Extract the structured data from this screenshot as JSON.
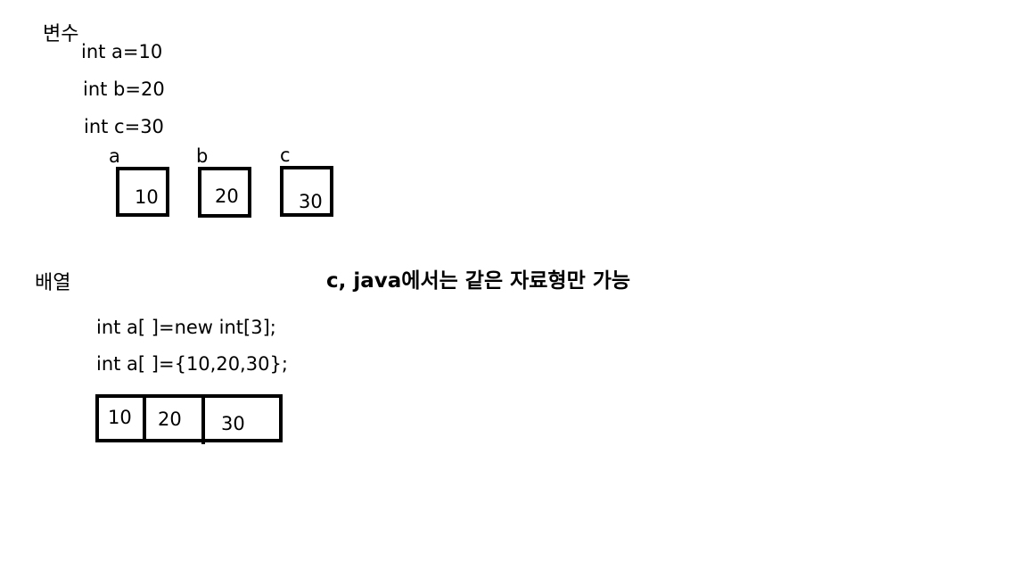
{
  "variables": {
    "heading": "변수",
    "declarations": [
      "int  a=10",
      "int  b=20",
      "int  c=30"
    ],
    "boxes": [
      {
        "label": "a",
        "value": "10"
      },
      {
        "label": "b",
        "value": "20"
      },
      {
        "label": "c",
        "value": "30"
      }
    ]
  },
  "arrays": {
    "heading": "배열",
    "note": "c, java에서는 같은 자료형만 가능",
    "declarations": [
      "int a[ ]=new int[3];",
      "int a[ ]={10,20,30};"
    ],
    "cells": [
      "10",
      "20",
      "30"
    ]
  }
}
